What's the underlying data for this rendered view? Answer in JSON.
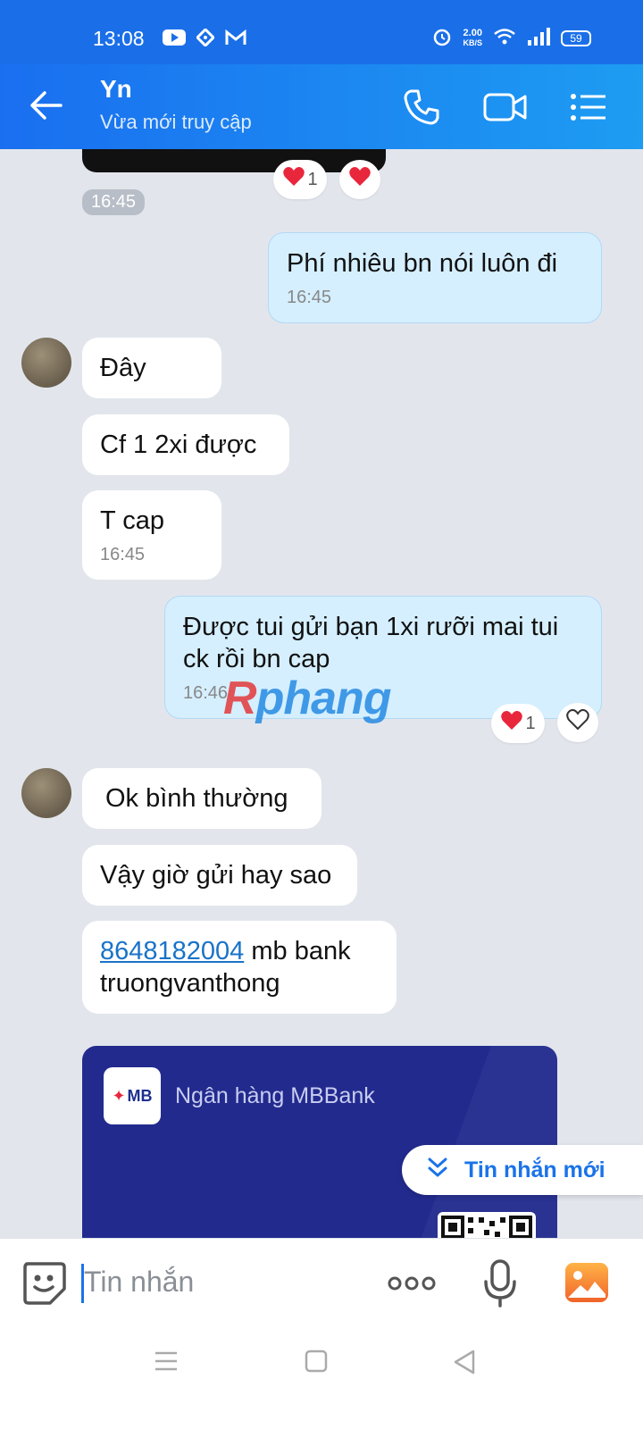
{
  "status_bar": {
    "time": "13:08",
    "net_speed_value": "2.00",
    "net_speed_unit": "KB/S",
    "battery": "59"
  },
  "header": {
    "contact_name": "Yn",
    "status": "Vừa mới truy cập"
  },
  "chat": {
    "reactions_top": {
      "count": "1"
    },
    "time_tag": "16:45",
    "messages": [
      {
        "text": "Phí nhiêu bn nói luôn đi",
        "time": "16:45"
      },
      {
        "text": "Đây"
      },
      {
        "text": "Cf 1 2xi được"
      },
      {
        "text": "T cap",
        "time": "16:45"
      },
      {
        "text": "Được tui gửi bạn 1xi rưỡi mai tui ck rồi bn cap",
        "time": "16:46",
        "reaction_count": "1"
      },
      {
        "text": "Ok bình thường"
      },
      {
        "text": "Vậy giờ gửi hay sao"
      },
      {
        "link": "8648182004",
        "text_after": " mb bank",
        "text_line2": "truongvanthong"
      }
    ],
    "bank_card": {
      "logo_text": "MB",
      "bank_name": "Ngân hàng MBBank"
    },
    "new_messages_button": "Tin nhắn mới",
    "watermark": {
      "part1": "R",
      "part2": "phang"
    }
  },
  "input": {
    "placeholder": "Tin nhắn"
  },
  "colors": {
    "header_blue": "#1a6ff0",
    "outgoing_bubble": "#d5efff",
    "link_blue": "#1a73c8",
    "heart_red": "#e8263c"
  }
}
